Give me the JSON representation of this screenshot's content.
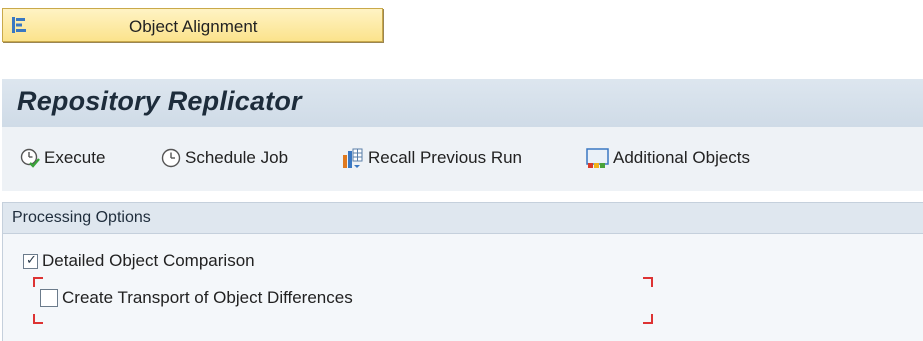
{
  "object_alignment": {
    "label": "Object Alignment",
    "icon": "tree-structure-icon"
  },
  "page": {
    "title": "Repository Replicator"
  },
  "toolbar": {
    "execute_label": "Execute",
    "schedule_label": "Schedule Job",
    "recall_label": "Recall Previous Run",
    "additional_label": "Additional Objects"
  },
  "processing_options": {
    "title": "Processing Options",
    "detailed_label": "Detailed Object Comparison",
    "detailed_checked": true,
    "transport_label": "Create Transport of Object Differences",
    "transport_checked": false
  },
  "colors": {
    "highlight": "#fbe38c",
    "title_bar": "#d6e0ea",
    "focus": "#dd3333"
  }
}
